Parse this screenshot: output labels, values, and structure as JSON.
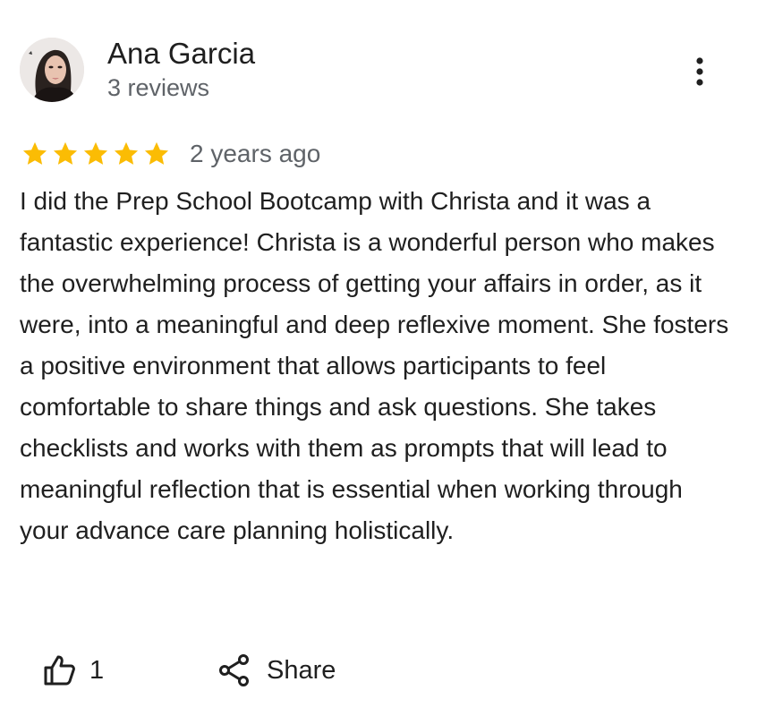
{
  "author": {
    "name": "Ana Garcia",
    "meta": "3 reviews"
  },
  "rating": {
    "stars": 5,
    "max": 5,
    "color": "#fbbc04",
    "date": "2 years ago"
  },
  "review": {
    "text": "I did the Prep School Bootcamp with Christa and it was a fantastic experience! Christa is a wonderful person who makes the overwhelming process of getting your affairs in order, as it were, into a meaningful and deep reflexive moment. She fosters a positive environment that allows participants to feel comfortable to share things and ask questions. She takes checklists and works with them as prompts that will lead to meaningful reflection that is essential when working through your advance care planning holistically."
  },
  "actions": {
    "like_icon": "thumbs-up-icon",
    "like_count": "1",
    "share_icon": "share-icon",
    "share_label": "Share"
  },
  "menu": {
    "icon": "more-vertical-icon"
  }
}
